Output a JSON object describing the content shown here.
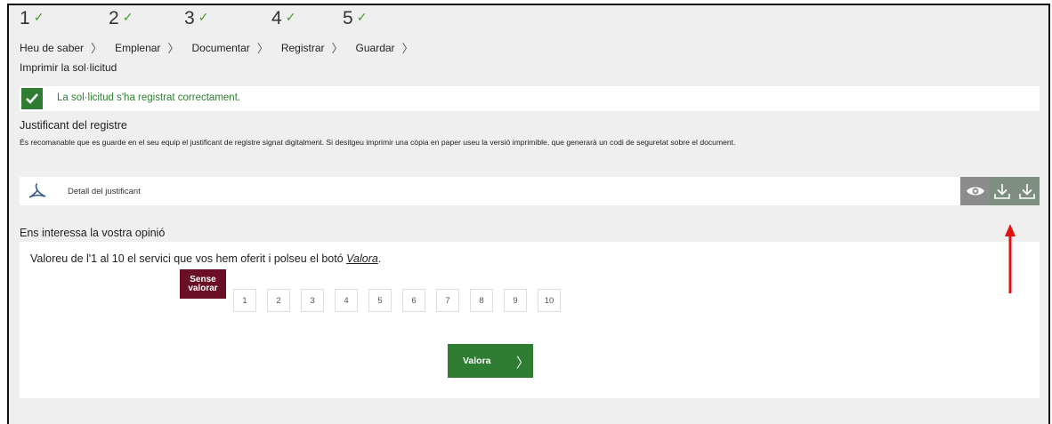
{
  "steps": [
    {
      "number": "1",
      "done": "✓"
    },
    {
      "number": "2",
      "done": "✓"
    },
    {
      "number": "3",
      "done": "✓"
    },
    {
      "number": "4",
      "done": "✓"
    },
    {
      "number": "5",
      "done": "✓"
    }
  ],
  "breadcrumbs": [
    "Heu de saber",
    "Emplenar",
    "Documentar",
    "Registrar",
    "Guardar"
  ],
  "page_subtitle": "Imprimir la sol·licitud",
  "success_message": "La sol·licitud s'ha registrat correctament.",
  "justificant": {
    "title": "Justificant del registre",
    "description": "És recomanable que es guarde en el seu equip el justificant de registre signat digitalment. Si desitgeu imprimir una còpia en paper useu la versió imprimible, que generarà un codi de seguretat sobre el document.",
    "detail_label": "Detall del justificant",
    "icons": [
      "pdf-icon",
      "eye-icon",
      "download-icon",
      "download-icon"
    ]
  },
  "opinion": {
    "title": "Ens interessa la vostra opinió",
    "instruction": "Valoreu de l'1 al 10 el servici que vos hem oferit i polseu el botó ",
    "instruction_link": "Valora",
    "instruction_end": ".",
    "no_rating_label": "Sense valorar",
    "scores": [
      "1",
      "2",
      "3",
      "4",
      "5",
      "6",
      "7",
      "8",
      "9",
      "10"
    ],
    "submit_label": "Valora"
  },
  "colors": {
    "accent_green": "#2e7d32",
    "no_rating_bg": "#6b0f24",
    "annotation_arrow": "#e01010"
  }
}
